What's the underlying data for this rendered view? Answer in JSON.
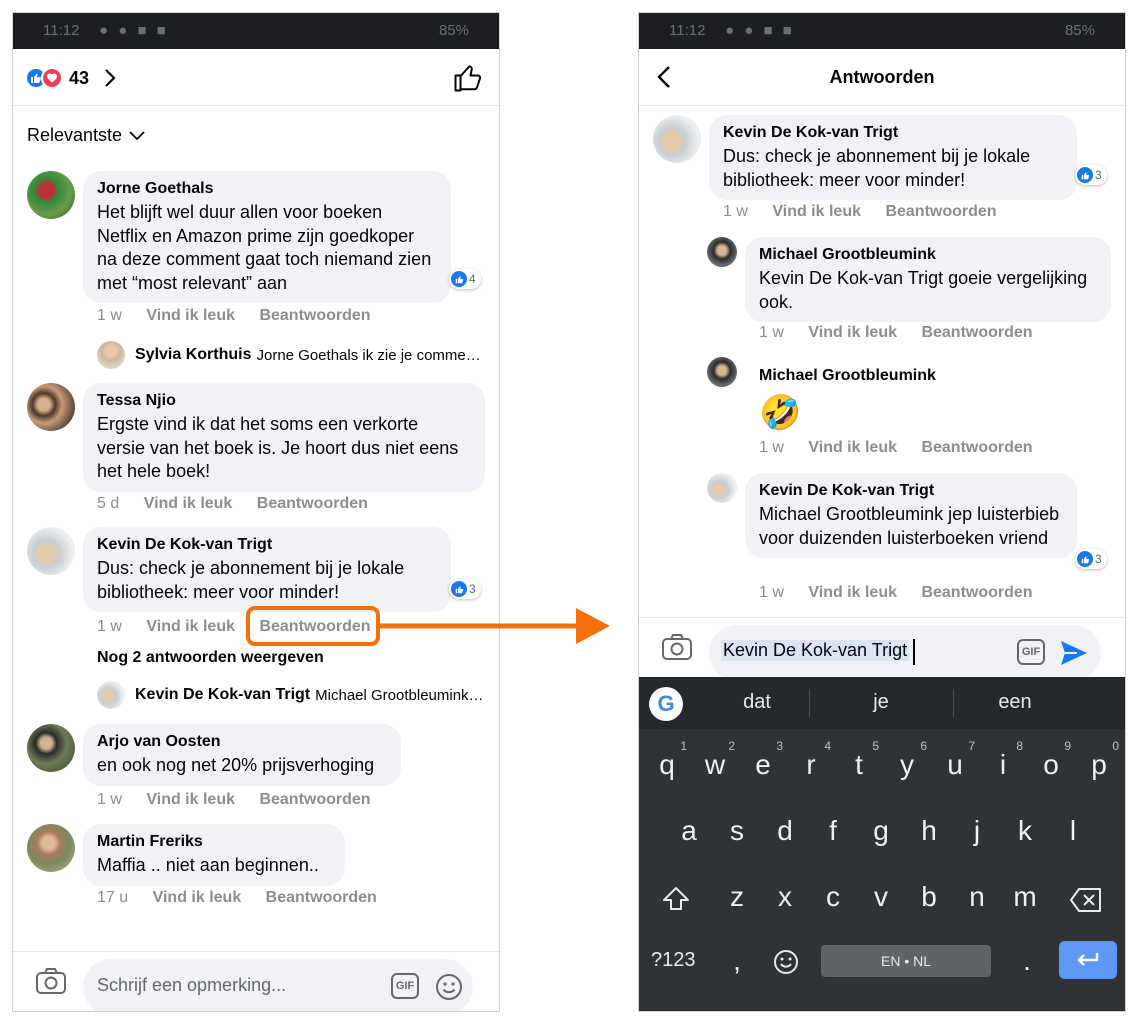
{
  "status_bar": {
    "time": "11:12",
    "battery": "85%"
  },
  "left": {
    "header": {
      "reaction_count": "43"
    },
    "sort_label": "Relevantste",
    "comments": [
      {
        "author": "Jorne Goethals",
        "text": "Het blijft wel duur allen voor boeken Netflix en Amazon prime zijn goedkoper na deze comment gaat toch niemand zien met “most relevant” aan",
        "age": "1 w",
        "reactions": "4"
      },
      {
        "author": "Tessa Njio",
        "text": "Ergste vind ik dat het soms een verkorte versie van het boek is. Je hoort dus niet eens het hele boek!",
        "age": "5 d"
      },
      {
        "author": "Kevin De Kok-van Trigt",
        "text": "Dus: check je abonnement bij je lokale bibliotheek: meer voor minder!",
        "age": "1 w",
        "reactions": "3"
      },
      {
        "author": "Arjo van Oosten",
        "text": "en ook nog net 20% prijsverhoging",
        "age": "1 w"
      },
      {
        "author": "Martin Freriks",
        "text": "Maffia .. niet aan beginnen..",
        "age": "17 u"
      }
    ],
    "reply_previews": [
      {
        "author": "Sylvia Korthuis",
        "text": "Jorne Goethals ik zie je comme…"
      },
      {
        "author": "Kevin De Kok-van Trigt",
        "text": "Michael Grootbleumink…"
      }
    ],
    "view_more_replies": "Nog 2 antwoorden weergeven",
    "actions": {
      "like": "Vind ik leuk",
      "reply": "Beantwoorden"
    },
    "composer_placeholder": "Schrijf een opmerking...",
    "gif_label": "GIF"
  },
  "right": {
    "title": "Antwoorden",
    "parent": {
      "author": "Kevin De Kok-van Trigt",
      "text": "Dus: check je abonnement bij je lokale bibliotheek: meer voor minder!",
      "age": "1 w",
      "reactions": "3"
    },
    "replies": [
      {
        "author": "Michael Grootbleumink",
        "text": "Kevin De Kok-van Trigt goeie vergelijking ook.",
        "age": "1 w"
      },
      {
        "author": "Michael Grootbleumink",
        "text": "🤣",
        "age": "1 w"
      },
      {
        "author": "Kevin De Kok-van Trigt",
        "text": "Michael Grootbleumink jep luisterbieb voor duizenden luisterboeken vriend",
        "age": "1 w",
        "reactions": "3"
      }
    ],
    "actions": {
      "like": "Vind ik leuk",
      "reply": "Beantwoorden"
    },
    "composer_value": "Kevin De Kok-van Trigt",
    "gif_label": "GIF",
    "keyboard": {
      "suggestions": [
        "dat",
        "je",
        "een"
      ],
      "row1": [
        "q",
        "w",
        "e",
        "r",
        "t",
        "y",
        "u",
        "i",
        "o",
        "p"
      ],
      "row1_hints": [
        "1",
        "2",
        "3",
        "4",
        "5",
        "6",
        "7",
        "8",
        "9",
        "0"
      ],
      "row2": [
        "a",
        "s",
        "d",
        "f",
        "g",
        "h",
        "j",
        "k",
        "l"
      ],
      "row3": [
        "z",
        "x",
        "c",
        "v",
        "b",
        "n",
        "m"
      ],
      "symbols_key": "?123",
      "comma": ",",
      "space_label": "EN • NL",
      "period": "."
    }
  },
  "colors": {
    "highlight": "#f56f0b",
    "facebook_blue": "#1877f2",
    "bubble": "#f0f2f5",
    "keyboard_bg": "#303336",
    "enter_key": "#5e97f6"
  }
}
